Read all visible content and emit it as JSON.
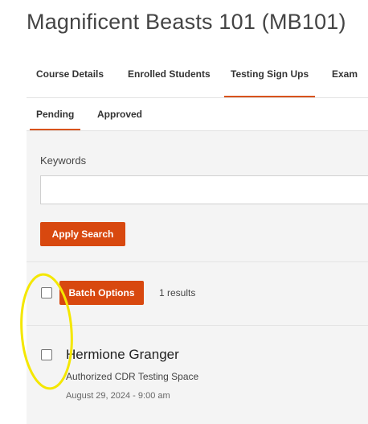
{
  "page_title": "Magnificent Beasts 101 (MB101)",
  "tabs": [
    "Course Details",
    "Enrolled Students",
    "Testing Sign Ups",
    "Exam"
  ],
  "active_tab": "Testing Sign Ups",
  "subtabs": [
    "Pending",
    "Approved"
  ],
  "active_subtab": "Pending",
  "search": {
    "label": "Keywords",
    "value": "",
    "apply_label": "Apply Search"
  },
  "batch": {
    "label": "Batch Options",
    "results_text": "1 results"
  },
  "student": {
    "name": "Hermione Granger",
    "space": "Authorized CDR Testing Space",
    "date": "August 29, 2024 - 9:00 am"
  },
  "colors": {
    "accent": "#d8480f",
    "highlight": "#f4e700",
    "panel": "#f4f4f4"
  }
}
